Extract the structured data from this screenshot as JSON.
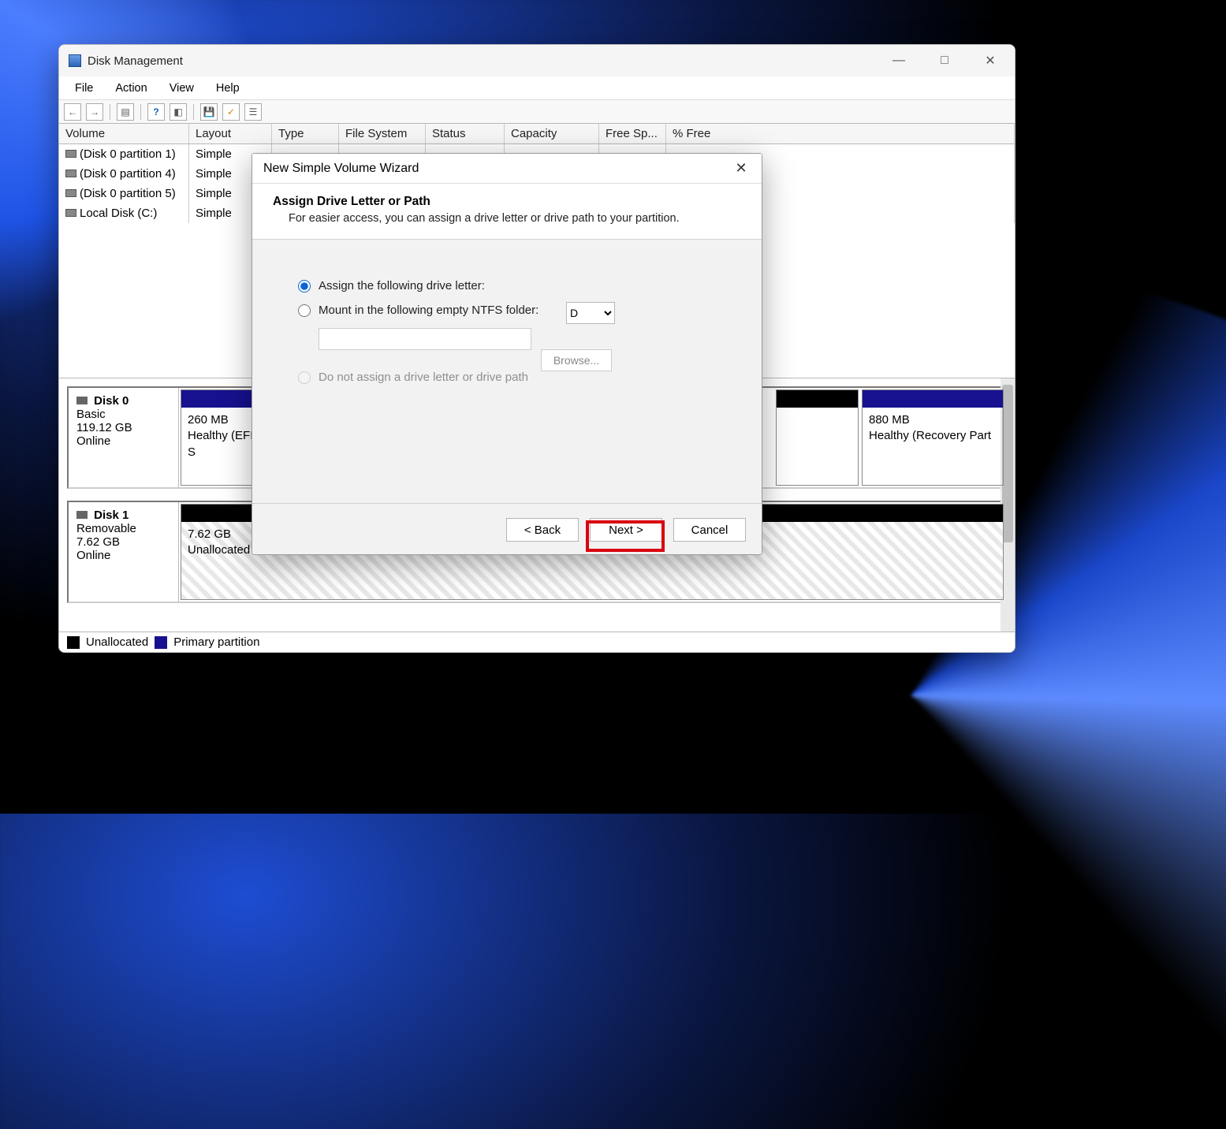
{
  "window": {
    "title": "Disk Management",
    "menus": {
      "file": "File",
      "action": "Action",
      "view": "View",
      "help": "Help"
    }
  },
  "columns": {
    "volume": "Volume",
    "layout": "Layout",
    "type": "Type",
    "fs": "File System",
    "status": "Status",
    "capacity": "Capacity",
    "free": "Free Sp...",
    "pct": "% Free"
  },
  "volumes": [
    {
      "name": "(Disk 0 partition 1)",
      "layout": "Simple"
    },
    {
      "name": "(Disk 0 partition 4)",
      "layout": "Simple"
    },
    {
      "name": "(Disk 0 partition 5)",
      "layout": "Simple"
    },
    {
      "name": "Local Disk (C:)",
      "layout": "Simple"
    }
  ],
  "disks": [
    {
      "name": "Disk 0",
      "type": "Basic",
      "size": "119.12 GB",
      "status": "Online",
      "parts": [
        {
          "size": "260 MB",
          "desc": "Healthy (EFI S",
          "kind": "primary"
        },
        {
          "size": "880 MB",
          "desc": "Healthy (Recovery Part",
          "kind": "primary"
        }
      ]
    },
    {
      "name": "Disk 1",
      "type": "Removable",
      "size": "7.62 GB",
      "status": "Online",
      "parts": [
        {
          "size": "7.62 GB",
          "desc": "Unallocated",
          "kind": "unallocated"
        }
      ]
    }
  ],
  "legend": {
    "unallocated": "Unallocated",
    "primary": "Primary partition"
  },
  "wizard": {
    "title": "New Simple Volume Wizard",
    "heading": "Assign Drive Letter or Path",
    "subtitle": "For easier access, you can assign a drive letter or drive path to your partition.",
    "opt_assign": "Assign the following drive letter:",
    "opt_mount": "Mount in the following empty NTFS folder:",
    "opt_none": "Do not assign a drive letter or drive path",
    "drive_letter": "D",
    "browse": "Browse...",
    "back": "< Back",
    "next": "Next >",
    "cancel": "Cancel"
  }
}
